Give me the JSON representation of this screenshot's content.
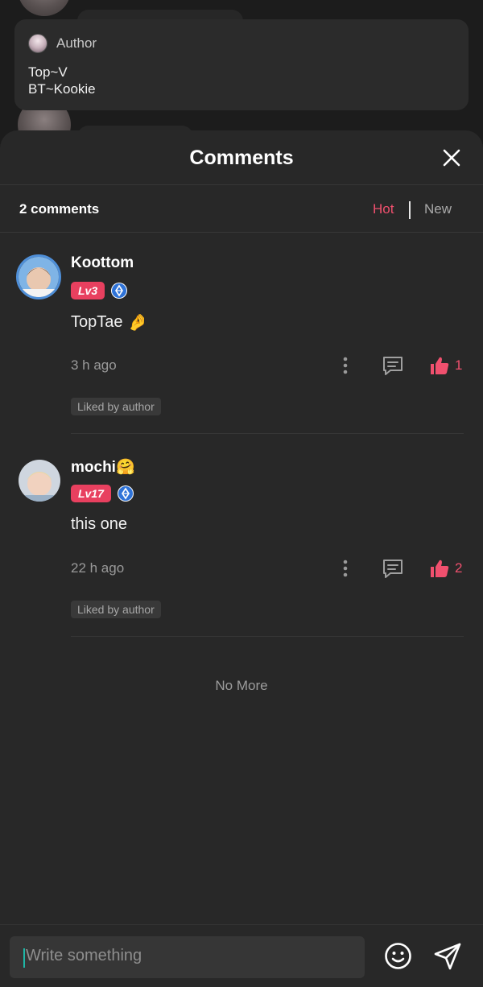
{
  "author_card": {
    "label": "Author",
    "lines": [
      "Top~V",
      "BT~Kookie"
    ]
  },
  "sheet": {
    "title": "Comments",
    "count_label": "2 comments",
    "sort_hot": "Hot",
    "sort_new": "New",
    "active_sort": "Hot"
  },
  "comments": [
    {
      "username": "Koottom",
      "level": "Lv3",
      "text": "TopTae",
      "text_emoji": "🤌",
      "time": "3 h ago",
      "likes": "1",
      "liked_by_author": "Liked by author"
    },
    {
      "username": "mochi",
      "username_emoji": "🤗",
      "level": "Lv17",
      "text": "this one",
      "time": "22 h ago",
      "likes": "2",
      "liked_by_author": "Liked by author"
    }
  ],
  "no_more": "No More",
  "composer": {
    "placeholder": "Write something"
  },
  "colors": {
    "accent": "#f0506e",
    "level_badge": "#e8405f",
    "sheet_bg": "#282828",
    "diamond_blue": "#2f73d8"
  },
  "icons": {
    "close": "close-icon",
    "more": "more-vertical-icon",
    "reply": "comment-icon",
    "like": "thumbs-up-icon",
    "diamond": "diamond-badge-icon",
    "emoji": "emoji-icon",
    "send": "send-icon"
  }
}
